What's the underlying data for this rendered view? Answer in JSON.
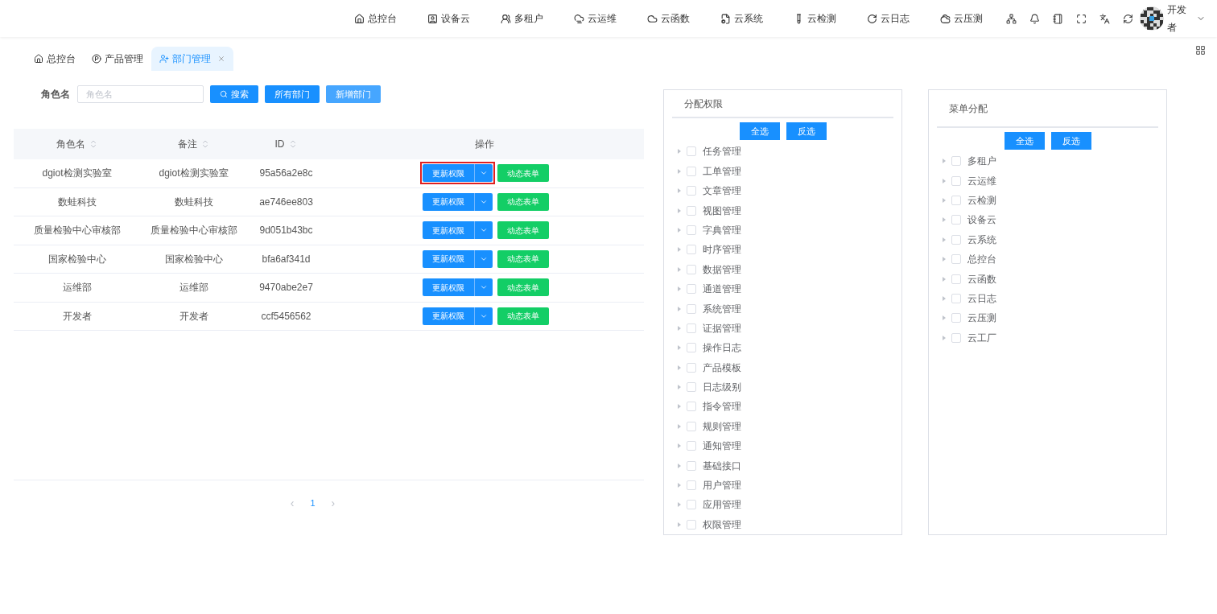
{
  "top_nav": {
    "items": [
      {
        "label": "总控台"
      },
      {
        "label": "设备云"
      },
      {
        "label": "多租户"
      },
      {
        "label": "云运维"
      },
      {
        "label": "云函数"
      },
      {
        "label": "云系统"
      },
      {
        "label": "云检测"
      },
      {
        "label": "云日志"
      },
      {
        "label": "云压测"
      }
    ],
    "user": {
      "name": "开发者"
    }
  },
  "tabs": [
    {
      "label": "总控台",
      "selected": false,
      "closable": false
    },
    {
      "label": "产品管理",
      "selected": false,
      "closable": false
    },
    {
      "label": "部门管理",
      "selected": true,
      "closable": true
    }
  ],
  "filter": {
    "label": "角色名",
    "placeholder": "角色名",
    "buttons": [
      {
        "label": "搜索",
        "kind": "search"
      },
      {
        "label": "所有部门",
        "kind": "primary"
      },
      {
        "label": "新增部门",
        "kind": "light"
      }
    ]
  },
  "table": {
    "columns": [
      {
        "label": "角色名",
        "sortable": true
      },
      {
        "label": "备注",
        "sortable": true
      },
      {
        "label": "ID",
        "sortable": true
      },
      {
        "label": "操作",
        "sortable": false
      }
    ],
    "rows": [
      {
        "name": "dgiot检测实验室",
        "remark": "dgiot检测实验室",
        "id": "95a56a2e8c",
        "update_label": "更新权限",
        "form_label": "动态表单",
        "highlighted": true
      },
      {
        "name": "数蛙科技",
        "remark": "数蛙科技",
        "id": "ae746ee803",
        "update_label": "更新权限",
        "form_label": "动态表单",
        "highlighted": false
      },
      {
        "name": "质量检验中心审核部",
        "remark": "质量检验中心审核部",
        "id": "9d051b43bc",
        "update_label": "更新权限",
        "form_label": "动态表单",
        "highlighted": false
      },
      {
        "name": "国家检验中心",
        "remark": "国家检验中心",
        "id": "bfa6af341d",
        "update_label": "更新权限",
        "form_label": "动态表单",
        "highlighted": false
      },
      {
        "name": "运维部",
        "remark": "运维部",
        "id": "9470abe2e7",
        "update_label": "更新权限",
        "form_label": "动态表单",
        "highlighted": false
      },
      {
        "name": "开发者",
        "remark": "开发者",
        "id": "ccf5456562",
        "update_label": "更新权限",
        "form_label": "动态表单",
        "highlighted": false
      }
    ]
  },
  "pagination": {
    "prev": "‹",
    "pages": [
      {
        "label": "1",
        "selected": true
      }
    ],
    "next": "›"
  },
  "panels": [
    {
      "title": "分配权限",
      "buttons": [
        "全选",
        "反选"
      ],
      "items": [
        {
          "label": "任务管理",
          "checked": false,
          "expanded": false
        },
        {
          "label": "工单管理",
          "checked": false,
          "expanded": false
        },
        {
          "label": "文章管理",
          "checked": false,
          "expanded": false
        },
        {
          "label": "视图管理",
          "checked": false,
          "expanded": false
        },
        {
          "label": "字典管理",
          "checked": false,
          "expanded": false
        },
        {
          "label": "时序管理",
          "checked": false,
          "expanded": false
        },
        {
          "label": "数据管理",
          "checked": false,
          "expanded": false
        },
        {
          "label": "通道管理",
          "checked": false,
          "expanded": false
        },
        {
          "label": "系统管理",
          "checked": false,
          "expanded": false
        },
        {
          "label": "证据管理",
          "checked": false,
          "expanded": false
        },
        {
          "label": "操作日志",
          "checked": false,
          "expanded": false
        },
        {
          "label": "产品模板",
          "checked": false,
          "expanded": false
        },
        {
          "label": "日志级别",
          "checked": false,
          "expanded": false
        },
        {
          "label": "指令管理",
          "checked": false,
          "expanded": false
        },
        {
          "label": "规则管理",
          "checked": false,
          "expanded": false
        },
        {
          "label": "通知管理",
          "checked": false,
          "expanded": false
        },
        {
          "label": "基础接口",
          "checked": false,
          "expanded": false
        },
        {
          "label": "用户管理",
          "checked": false,
          "expanded": false
        },
        {
          "label": "应用管理",
          "checked": false,
          "expanded": false
        },
        {
          "label": "权限管理",
          "checked": false,
          "expanded": false
        }
      ]
    },
    {
      "title": "菜单分配",
      "buttons": [
        "全选",
        "反选"
      ],
      "items": [
        {
          "label": "多租户",
          "checked": false,
          "expanded": false
        },
        {
          "label": "云运维",
          "checked": false,
          "expanded": false
        },
        {
          "label": "云检测",
          "checked": false,
          "expanded": false
        },
        {
          "label": "设备云",
          "checked": false,
          "expanded": false
        },
        {
          "label": "云系统",
          "checked": false,
          "expanded": false
        },
        {
          "label": "总控台",
          "checked": false,
          "expanded": false
        },
        {
          "label": "云函数",
          "checked": false,
          "expanded": false
        },
        {
          "label": "云日志",
          "checked": false,
          "expanded": false
        },
        {
          "label": "云压测",
          "checked": false,
          "expanded": false
        },
        {
          "label": "云工厂",
          "checked": false,
          "expanded": false
        }
      ]
    }
  ]
}
